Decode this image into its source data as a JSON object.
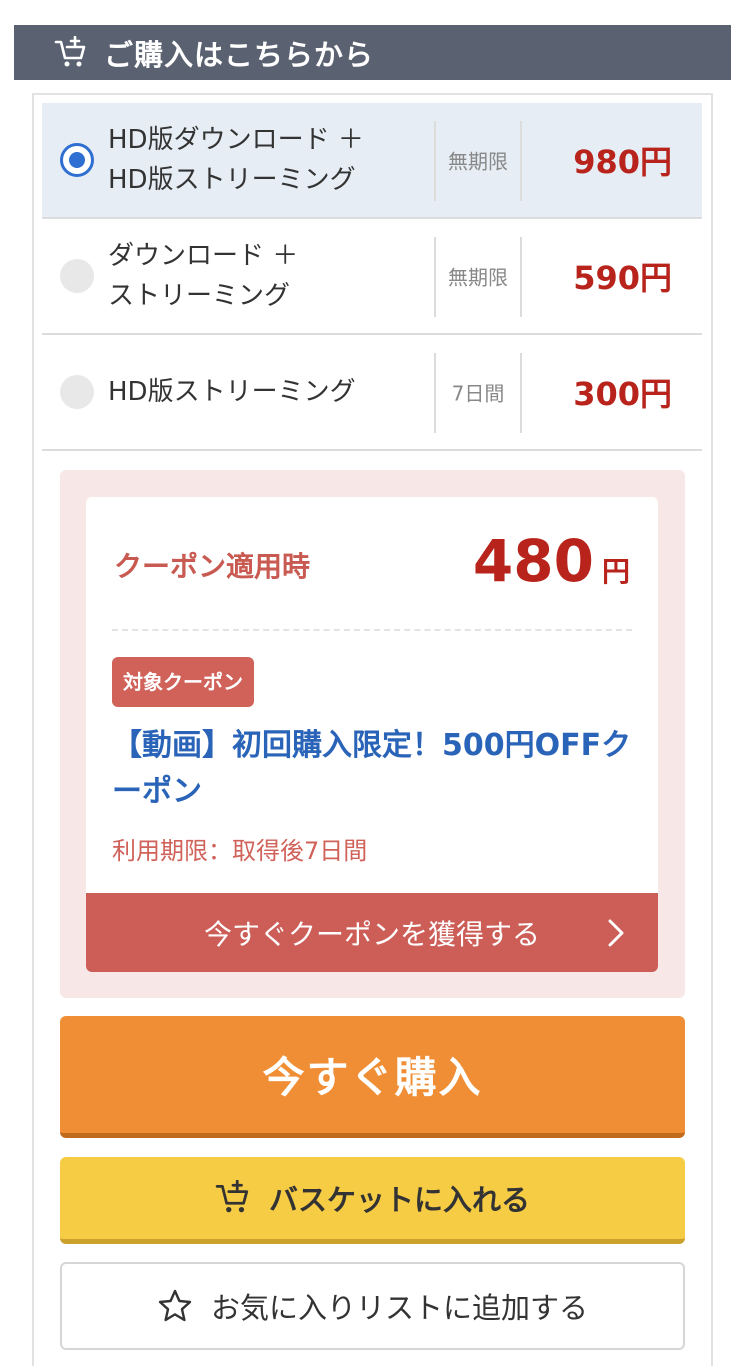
{
  "header": {
    "title": "ご購入はこちらから",
    "icon": "cart-plus-icon"
  },
  "options": [
    {
      "line1": "HD版ダウンロード ＋",
      "line2": "HD版ストリーミング",
      "period": "無期限",
      "price": "980円",
      "selected": true
    },
    {
      "line1": "ダウンロード ＋",
      "line2": "ストリーミング",
      "period": "無期限",
      "price": "590円",
      "selected": false
    },
    {
      "line1": "HD版ストリーミング",
      "line2": "",
      "period": "7日間",
      "price": "300円",
      "selected": false
    }
  ],
  "coupon": {
    "applied_label": "クーポン適用時",
    "applied_price": "480",
    "applied_unit": "円",
    "badge": "対象クーポン",
    "name": "【動画】初回購入限定！500円OFFクーポン",
    "expire": "利用期限：取得後7日間",
    "get_button": "今すぐクーポンを獲得する"
  },
  "buttons": {
    "buy_now": "今すぐ購入",
    "add_to_basket": "バスケットに入れる",
    "add_to_favorites": "お気に入りリストに追加する"
  },
  "colors": {
    "header_bg": "#5a6170",
    "selected_row_bg": "#e6edf4",
    "radio_selected": "#2f6fd1",
    "price_red": "#b8241c",
    "coupon_bg": "#f8e7e7",
    "coupon_red": "#cc5e57",
    "coupon_name_blue": "#2a64b8",
    "buy_orange": "#ef8e34",
    "basket_yellow": "#f6cc45"
  }
}
